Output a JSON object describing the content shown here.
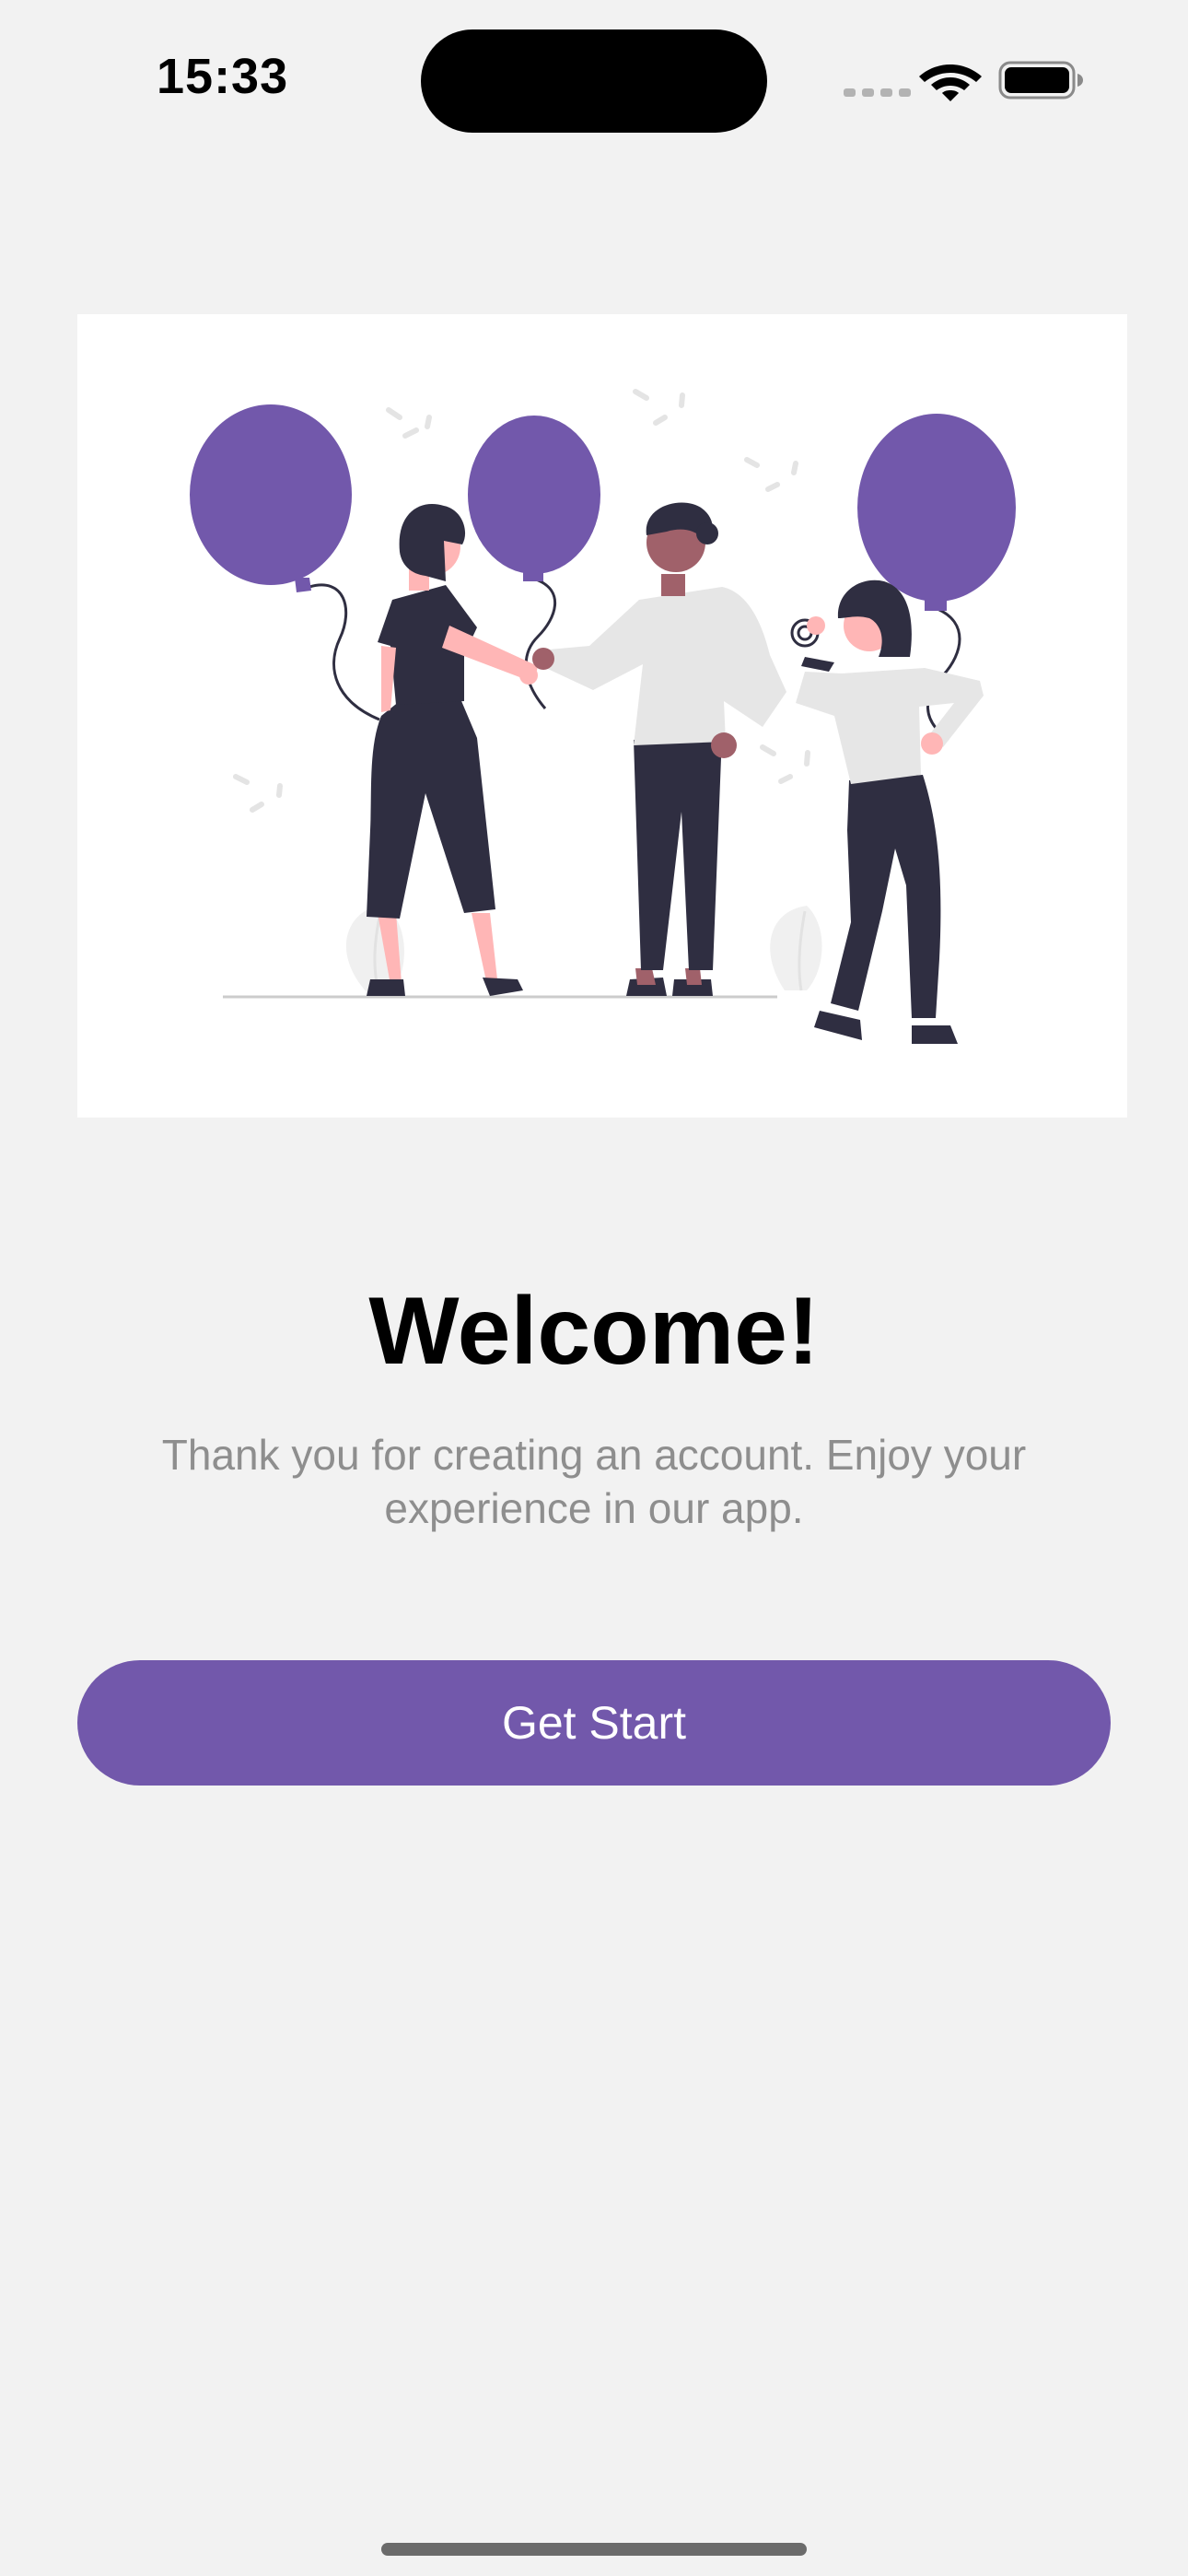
{
  "status_bar": {
    "time": "15:33",
    "icons": [
      "cellular-signal-icon",
      "wifi-icon",
      "battery-icon"
    ]
  },
  "illustration": {
    "name": "celebration-balloons-illustration",
    "colors": {
      "accent": "#7258ab",
      "dark": "#2f2e41",
      "skin_light": "#ffb6b6",
      "skin_dark": "#a0616a",
      "shirt": "#e6e6e6"
    }
  },
  "welcome": {
    "title": "Welcome!",
    "message": "Thank you for creating an account. Enjoy your experience in our app."
  },
  "button": {
    "label": "Get Start"
  },
  "colors": {
    "background": "#f2f2f2",
    "primary": "#7258ab",
    "text_primary": "#000000",
    "text_secondary": "#8e8e8e"
  }
}
